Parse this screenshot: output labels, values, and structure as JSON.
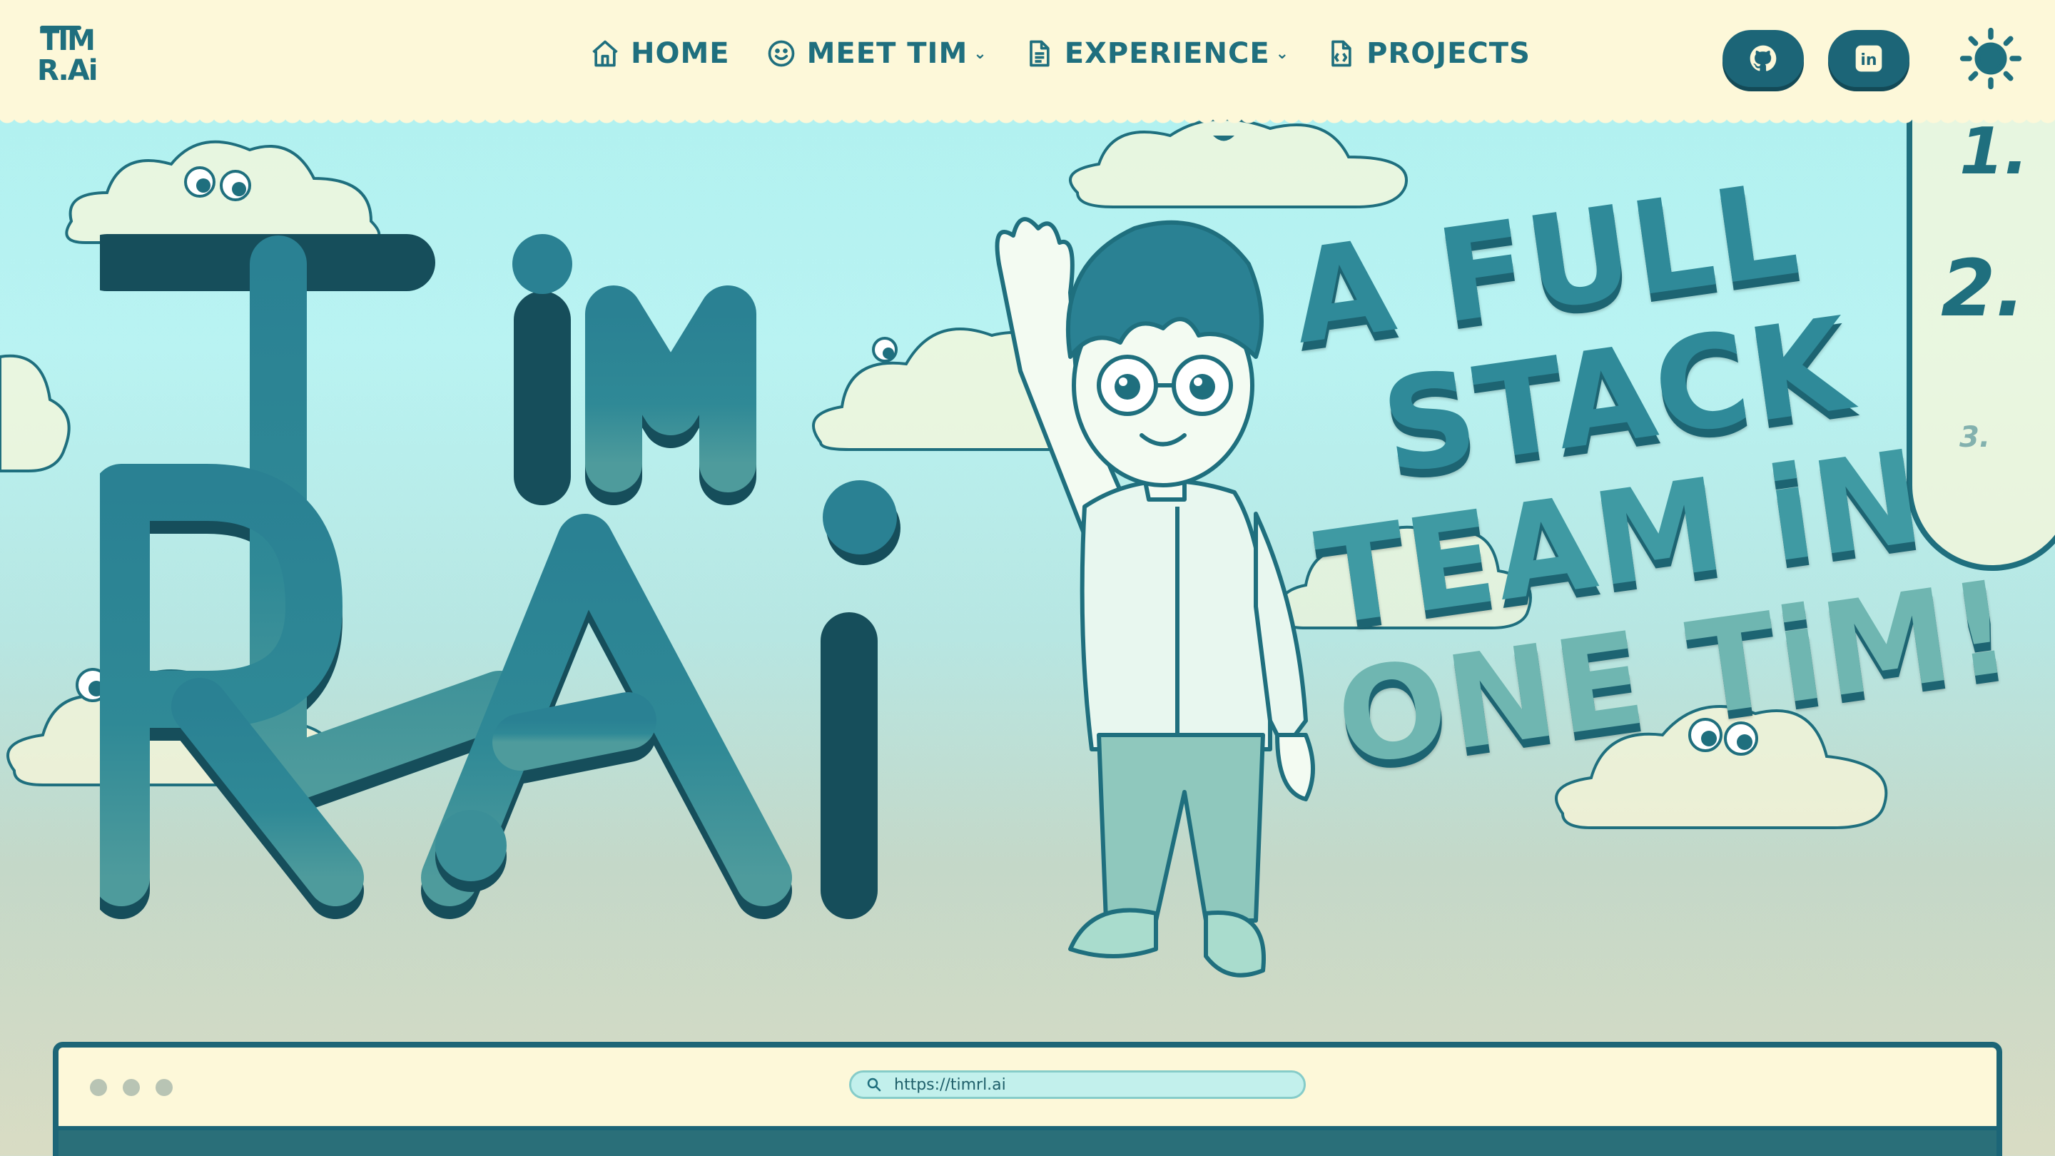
{
  "logo": {
    "top": "TIM",
    "bottom": "R.Ai"
  },
  "nav": {
    "items": [
      {
        "label": "HOME",
        "icon": "home-icon",
        "has_dropdown": false
      },
      {
        "label": "MEET TIM",
        "icon": "smiley-icon",
        "has_dropdown": true
      },
      {
        "label": "EXPERIENCE",
        "icon": "document-icon",
        "has_dropdown": true
      },
      {
        "label": "PROJECTS",
        "icon": "code-file-icon",
        "has_dropdown": false
      }
    ],
    "caret": "⌄",
    "social": [
      {
        "name": "github",
        "icon": "github-icon"
      },
      {
        "name": "linkedin",
        "icon": "linkedin-icon",
        "label": "in"
      }
    ],
    "theme_icon": "sun-icon"
  },
  "hero": {
    "logo_top": "TIM",
    "logo_bottom": "R.Ai",
    "tagline": [
      "A FULL",
      "STACK",
      "TEAM iN",
      "ONE TiM!"
    ],
    "list_numbers": [
      "1.",
      "2.",
      "3."
    ]
  },
  "browser": {
    "url": "https://timrl.ai"
  },
  "colors": {
    "primary": "#1f6f7e",
    "cream": "#fdf8d9",
    "sky": "#aef0ef",
    "button": "#1c6577"
  }
}
